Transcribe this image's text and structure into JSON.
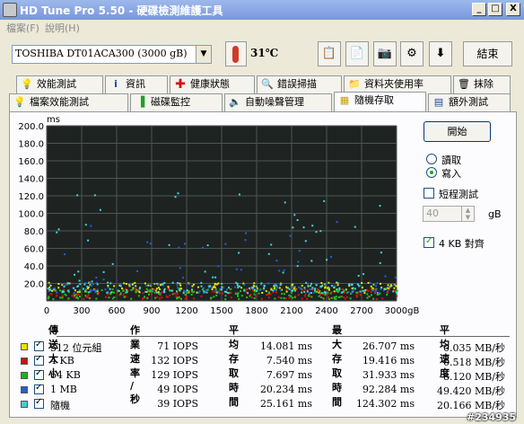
{
  "window": {
    "title": "HD Tune Pro 5.50 - 硬碟檢測維護工具",
    "minimize": "_",
    "maximize": "□",
    "close": "X"
  },
  "menu": {
    "file": "檔案(F)",
    "help": "說明(H)"
  },
  "toolbar": {
    "drive": "TOSHIBA DT01ACA300 (3000 gB)",
    "temperature": "31℃",
    "exit_label": "結束",
    "icons": [
      "copy-info-icon",
      "copy-screen-icon",
      "camera-icon",
      "settings-icon",
      "download-icon"
    ]
  },
  "tabs_row1": [
    {
      "label": "效能測試",
      "icon": "bulb-icon"
    },
    {
      "label": "資訊",
      "icon": "info-icon"
    },
    {
      "label": "健康狀態",
      "icon": "health-cross-icon"
    },
    {
      "label": "錯誤掃描",
      "icon": "magnifier-icon"
    },
    {
      "label": "資料夾使用率",
      "icon": "folder-icon"
    },
    {
      "label": "抹除",
      "icon": "trash-icon"
    }
  ],
  "tabs_row2": [
    {
      "label": "檔案效能測試",
      "icon": "file-bulb-icon"
    },
    {
      "label": "磁碟監控",
      "icon": "bar-monitor-icon"
    },
    {
      "label": "自動噪聲管理",
      "icon": "speaker-icon"
    },
    {
      "label": "隨機存取",
      "icon": "scatter-icon",
      "active": true
    },
    {
      "label": "額外測試",
      "icon": "extra-icon"
    }
  ],
  "controls": {
    "start_label": "開始",
    "read_label": "讀取",
    "write_label": "寫入",
    "mode_selected": "write",
    "short_test_label": "短程測試",
    "short_test_checked": false,
    "short_test_value": "40",
    "short_test_unit": "gB",
    "align_label": "4 KB 對齊",
    "align_checked": true
  },
  "chart_data": {
    "type": "scatter",
    "ylabel": "ms",
    "ylim": [
      0,
      200
    ],
    "yticks": [
      "200.0",
      "180.0",
      "160.0",
      "140.0",
      "120.0",
      "100.0",
      "80.0",
      "60.0",
      "40.0",
      "20.0"
    ],
    "xlim": [
      0,
      3000
    ],
    "xticks": [
      "0",
      "300",
      "600",
      "900",
      "1200",
      "1500",
      "1800",
      "2100",
      "2400",
      "2700",
      "3000gB"
    ],
    "grid": true,
    "series": [
      {
        "name": "512 位元組",
        "color": "#e8e800",
        "typical_ms": [
          10,
          22
        ]
      },
      {
        "name": "4 KB",
        "color": "#e01010",
        "typical_ms": [
          3,
          15
        ]
      },
      {
        "name": "64 KB",
        "color": "#20c020",
        "typical_ms": [
          3,
          15
        ]
      },
      {
        "name": "1 MB",
        "color": "#2060e0",
        "typical_ms": [
          10,
          92
        ]
      },
      {
        "name": "隨機",
        "color": "#40d8d8",
        "typical_ms": [
          10,
          124
        ]
      }
    ]
  },
  "table": {
    "headers": [
      "傳送大小",
      "作業速率 / 秒",
      "平均存取時間",
      "最大存取時間",
      "平均速度"
    ],
    "rows": [
      {
        "size": "512 位元組",
        "swatch": "#f0e000",
        "rate": "71 IOPS",
        "avg": "14.081 ms",
        "max": "26.707 ms",
        "speed": "0.035 MB/秒"
      },
      {
        "size": "4 KB",
        "swatch": "#d01010",
        "rate": "132 IOPS",
        "avg": "7.540 ms",
        "max": "19.416 ms",
        "speed": "0.518 MB/秒"
      },
      {
        "size": "64 KB",
        "swatch": "#20b020",
        "rate": "129 IOPS",
        "avg": "7.697 ms",
        "max": "31.933 ms",
        "speed": "8.120 MB/秒"
      },
      {
        "size": "1 MB",
        "swatch": "#2060d0",
        "rate": "49 IOPS",
        "avg": "20.234 ms",
        "max": "92.284 ms",
        "speed": "49.420 MB/秒"
      },
      {
        "size": "隨機",
        "swatch": "#40d0d0",
        "rate": "39 IOPS",
        "avg": "25.161 ms",
        "max": "124.302 ms",
        "speed": "20.166 MB/秒"
      }
    ]
  },
  "watermark": "#234935"
}
